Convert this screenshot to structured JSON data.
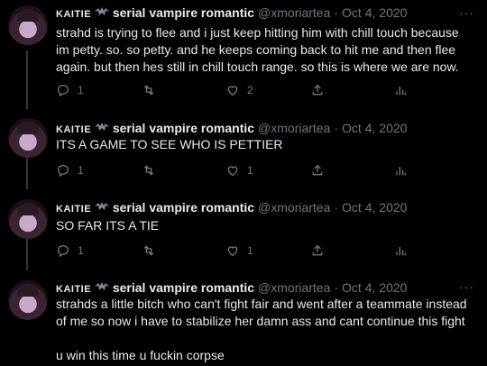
{
  "tweets": [
    {
      "display_name": "serial vampire romantic",
      "name_prefix": "KAITIE",
      "handle": "@xmoriartea",
      "separator": "·",
      "date": "Oct 4, 2020",
      "more": "···",
      "text": "strahd is trying to flee and i just keep hitting him with chill touch because im petty. so. so petty. and he keeps coming back to hit me and then flee again. but then hes still in chill touch range. so this is where we are now.",
      "replies": "1",
      "retweets": "",
      "likes": "2"
    },
    {
      "display_name": "serial vampire romantic",
      "name_prefix": "KAITIE",
      "handle": "@xmoriartea",
      "separator": "·",
      "date": "Oct 4, 2020",
      "more": "···",
      "text": "ITS A GAME TO SEE WHO IS PETTIER",
      "replies": "1",
      "retweets": "",
      "likes": "1"
    },
    {
      "display_name": "serial vampire romantic",
      "name_prefix": "KAITIE",
      "handle": "@xmoriartea",
      "separator": "·",
      "date": "Oct 4, 2020",
      "more": "···",
      "text": "SO FAR ITS A TIE",
      "replies": "1",
      "retweets": "",
      "likes": "1"
    },
    {
      "display_name": "serial vampire romantic",
      "name_prefix": "KAITIE",
      "handle": "@xmoriartea",
      "separator": "·",
      "date": "Oct 4, 2020",
      "more": "···",
      "text": "strahds a little bitch who can't fight fair and went after a teammate instead of me so now i have to stabilize her damn ass and cant continue this fight\n\nu win this time u fuckin corpse"
    }
  ],
  "icons": {
    "reply": "reply-icon",
    "retweet": "retweet-icon",
    "like": "heart-icon",
    "share": "share-icon",
    "analytics": "analytics-icon",
    "bat": "bat-icon"
  },
  "colors": {
    "background": "#000000",
    "text": "#e7e9ea",
    "muted": "#71767b",
    "thread_line": "#333639"
  }
}
